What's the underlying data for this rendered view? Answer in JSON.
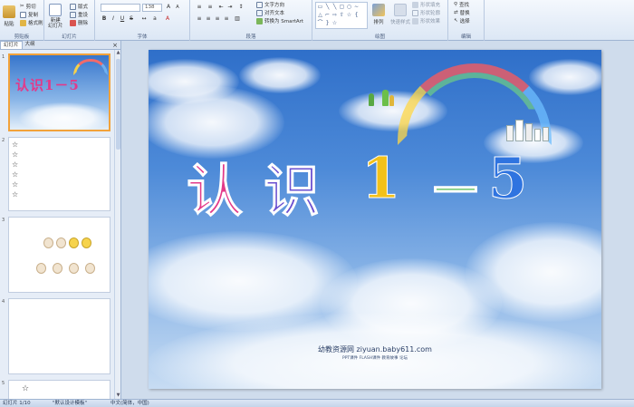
{
  "ribbon": {
    "clipboard": {
      "label": "剪贴板",
      "paste": "粘贴",
      "cut": "剪切",
      "copy": "复制",
      "format_painter": "格式刷"
    },
    "slides": {
      "label": "幻灯片",
      "new_slide": "新建\n幻灯片",
      "layout": "版式",
      "reset": "重设",
      "delete": "删除"
    },
    "font": {
      "label": "字体",
      "font_name": "",
      "font_size": "138",
      "bold": "B",
      "italic": "I",
      "underline": "U",
      "strike": "S"
    },
    "paragraph": {
      "label": "段落",
      "text_direction": "文字方向",
      "align_text": "对齐文本",
      "convert_smartart": "转换为 SmartArt"
    },
    "drawing": {
      "label": "绘图",
      "arrange": "排列",
      "quick_styles": "快速样式",
      "shape_fill": "形状填充",
      "shape_outline": "形状轮廓",
      "shape_effects": "形状效果"
    },
    "editing": {
      "label": "编辑",
      "find": "查找",
      "replace": "替换",
      "select": "选择"
    }
  },
  "left_pane": {
    "tabs": [
      {
        "label": "幻灯片"
      },
      {
        "label": "大纲"
      }
    ],
    "close": "×",
    "slides": [
      {
        "number": "1",
        "title": "认识1－5"
      },
      {
        "number": "2"
      },
      {
        "number": "3"
      },
      {
        "number": "4"
      },
      {
        "number": "5"
      }
    ]
  },
  "slide": {
    "title_chars": [
      {
        "char": "认",
        "color": "#e23a8a"
      },
      {
        "char": "识",
        "color": "#6a4fd0"
      },
      {
        "char": "1",
        "color": "#f2c11a"
      },
      {
        "char": "－",
        "color": "#4cb84a"
      },
      {
        "char": "5",
        "color": "#2f74e0"
      }
    ],
    "site": "幼教资源网 ziyuan.baby611.com",
    "site_sub": "PPT课件  FLASH课件  教育故事  论坛"
  },
  "status_bar": {
    "slide_info": "幻灯片 1/10",
    "theme": "\"默认设计模板\"",
    "language": "中文(简体，中国)"
  },
  "colors": {
    "ribbon_bg": "#dce7f5",
    "accent_selected": "#f2a23a",
    "sky_top": "#2f6fc9"
  }
}
